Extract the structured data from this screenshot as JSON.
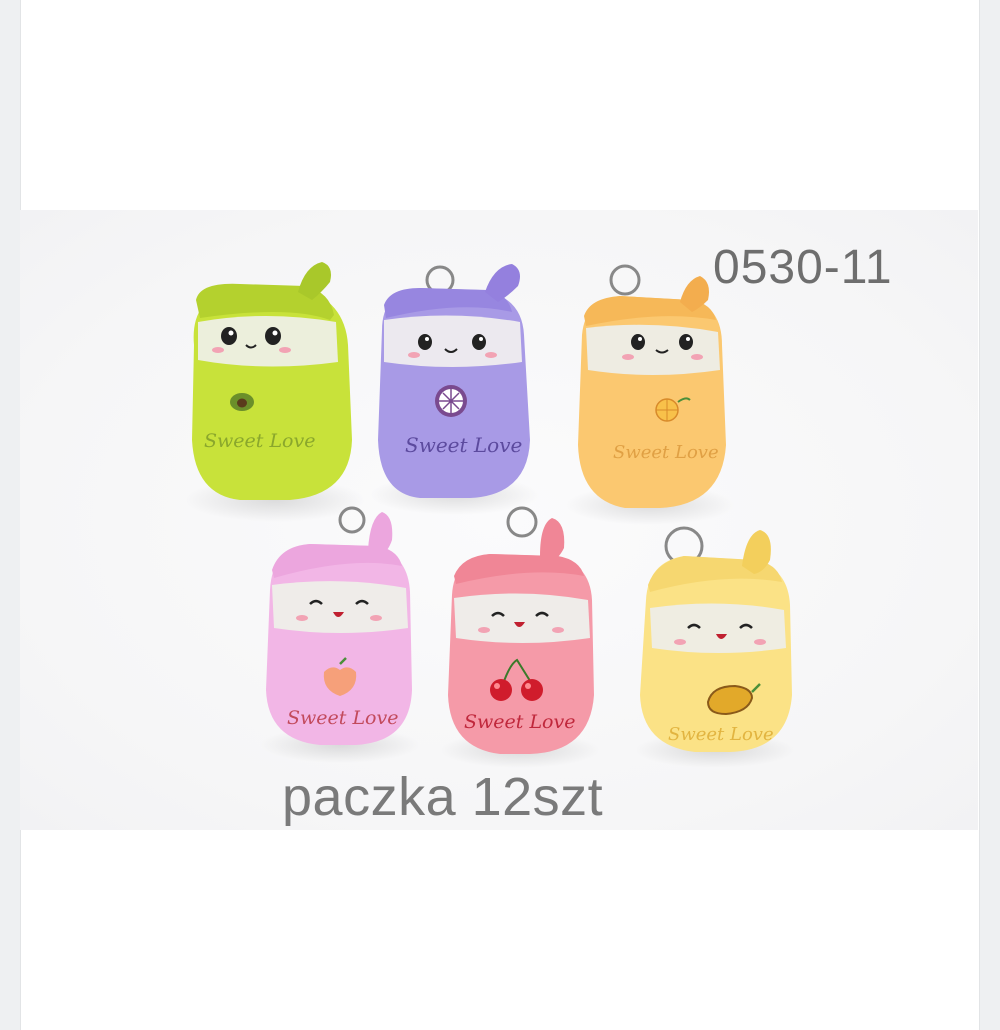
{
  "product_code": "0530-11",
  "caption": "paczka 12szt",
  "embroidery_text": "Sweet Love",
  "toys": [
    {
      "name": "avocado",
      "color": "#c8e23a",
      "accent": "#a9c82a",
      "icon": "avocado-icon"
    },
    {
      "name": "mangosteen",
      "color": "#a89ae6",
      "accent": "#8b79d6",
      "icon": "mangosteen-slice-icon"
    },
    {
      "name": "orange",
      "color": "#fbc870",
      "accent": "#f3ad4e",
      "icon": "orange-slice-icon"
    },
    {
      "name": "peach",
      "color": "#f2b6e6",
      "accent": "#e79ad8",
      "icon": "peach-icon"
    },
    {
      "name": "cherry",
      "color": "#f59aa8",
      "accent": "#ec7d90",
      "icon": "cherry-icon"
    },
    {
      "name": "mango",
      "color": "#fbe286",
      "accent": "#f3cf5c",
      "icon": "mango-icon"
    }
  ]
}
